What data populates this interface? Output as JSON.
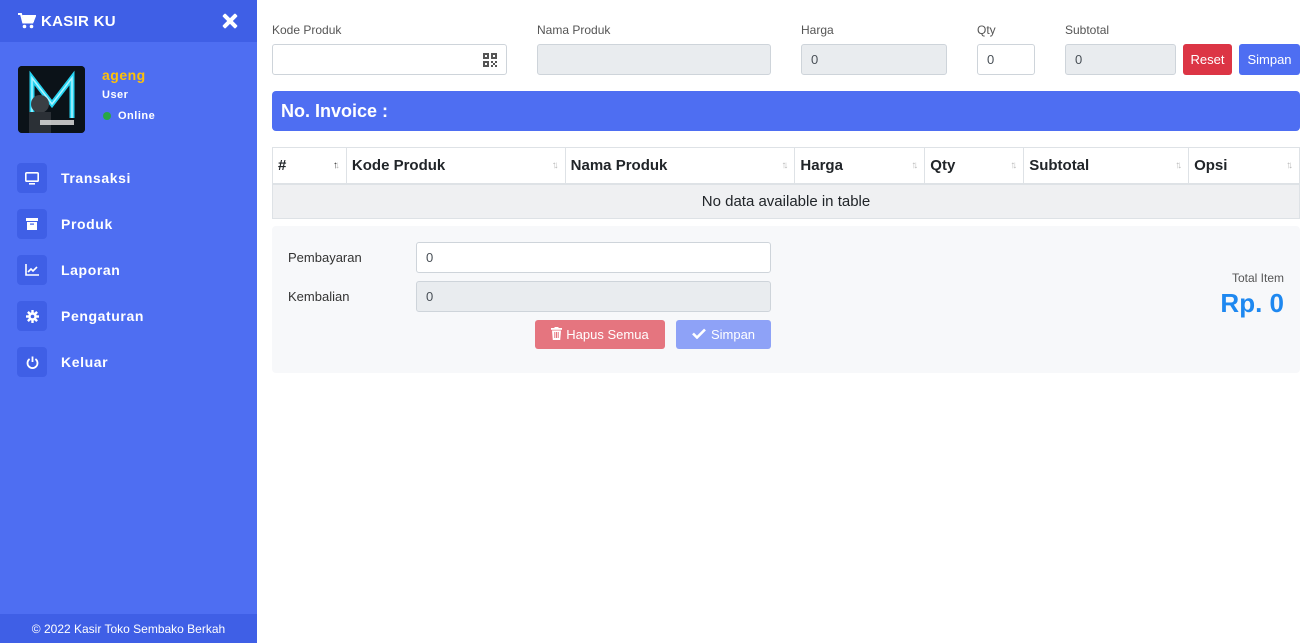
{
  "sidebar": {
    "brand": "KASIR KU",
    "user": {
      "name": "ageng",
      "role": "User",
      "status": "Online"
    },
    "menu": [
      {
        "label": "Transaksi",
        "icon": "monitor-icon"
      },
      {
        "label": "Produk",
        "icon": "archive-icon"
      },
      {
        "label": "Laporan",
        "icon": "chart-icon"
      },
      {
        "label": "Pengaturan",
        "icon": "gear-icon"
      },
      {
        "label": "Keluar",
        "icon": "power-icon"
      }
    ],
    "footer": "© 2022 Kasir Toko Sembako Berkah"
  },
  "form": {
    "kode_produk_label": "Kode Produk",
    "kode_produk_value": "",
    "nama_produk_label": "Nama Produk",
    "nama_produk_value": "",
    "harga_label": "Harga",
    "harga_value": "0",
    "qty_label": "Qty",
    "qty_value": "0",
    "subtotal_label": "Subtotal",
    "subtotal_value": "0",
    "reset_label": "Reset",
    "simpan_label": "Simpan"
  },
  "invoice": {
    "label": "No. Invoice :"
  },
  "table": {
    "columns": [
      "#",
      "Kode Produk",
      "Nama Produk",
      "Harga",
      "Qty",
      "Subtotal",
      "Opsi"
    ],
    "empty_message": "No data available in table"
  },
  "payment": {
    "pembayaran_label": "Pembayaran",
    "pembayaran_value": "0",
    "kembalian_label": "Kembalian",
    "kembalian_value": "0",
    "hapus_label": "Hapus Semua",
    "simpan_label": "Simpan",
    "total_item_label": "Total Item",
    "total_value": "Rp. 0"
  },
  "colors": {
    "sidebar": "#4e6ef2",
    "sidebar_dark": "#3f5fe6",
    "accent": "#4e6ef2",
    "danger": "#dc3545",
    "username": "#ffc107",
    "online": "#28a745",
    "total": "#1e88f0"
  }
}
